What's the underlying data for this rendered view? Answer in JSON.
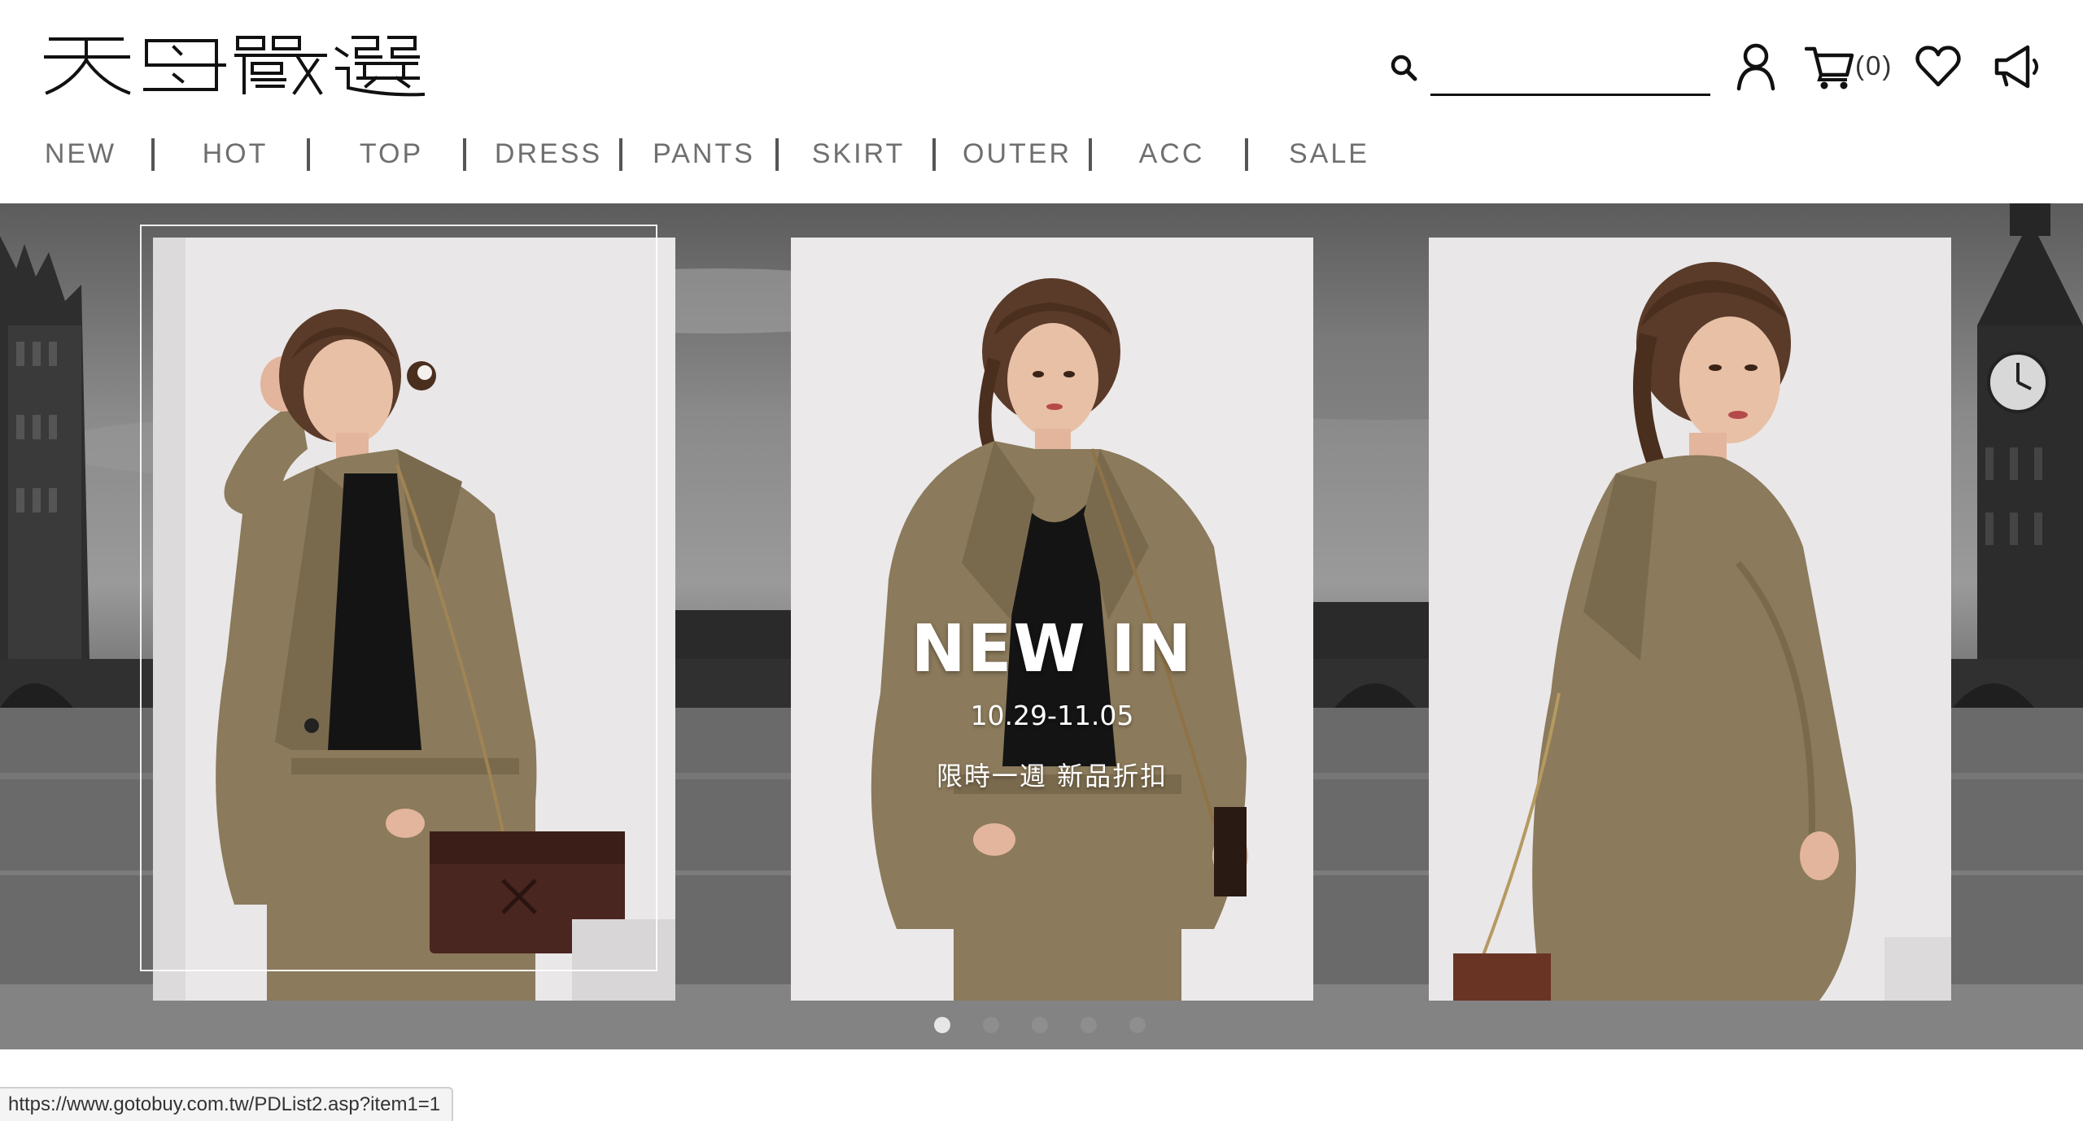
{
  "brand": {
    "logo_text": "天母嚴選"
  },
  "search": {
    "placeholder": "",
    "value": ""
  },
  "header": {
    "cart_count": "(0)"
  },
  "nav": {
    "items": [
      {
        "label": "NEW"
      },
      {
        "label": "HOT"
      },
      {
        "label": "TOP"
      },
      {
        "label": "DRESS"
      },
      {
        "label": "PANTS"
      },
      {
        "label": "SKIRT"
      },
      {
        "label": "OUTER"
      },
      {
        "label": "ACC"
      },
      {
        "label": "SALE"
      }
    ]
  },
  "banner": {
    "title": "NEW IN",
    "dates": "10.29-11.05",
    "subtitle": "限時一週  新品折扣",
    "slides_total": 5,
    "active_slide": 1
  },
  "status_bar": {
    "url": "https://www.gotobuy.com.tw/PDList2.asp?item1=1"
  },
  "colors": {
    "nav_text": "#6f6f6f",
    "jacket_khaki": "#8b7a5b",
    "photo_bg": "#e9e7e8",
    "dot_active": "#e6e6e6",
    "dot_inactive": "#8e8e8e"
  }
}
